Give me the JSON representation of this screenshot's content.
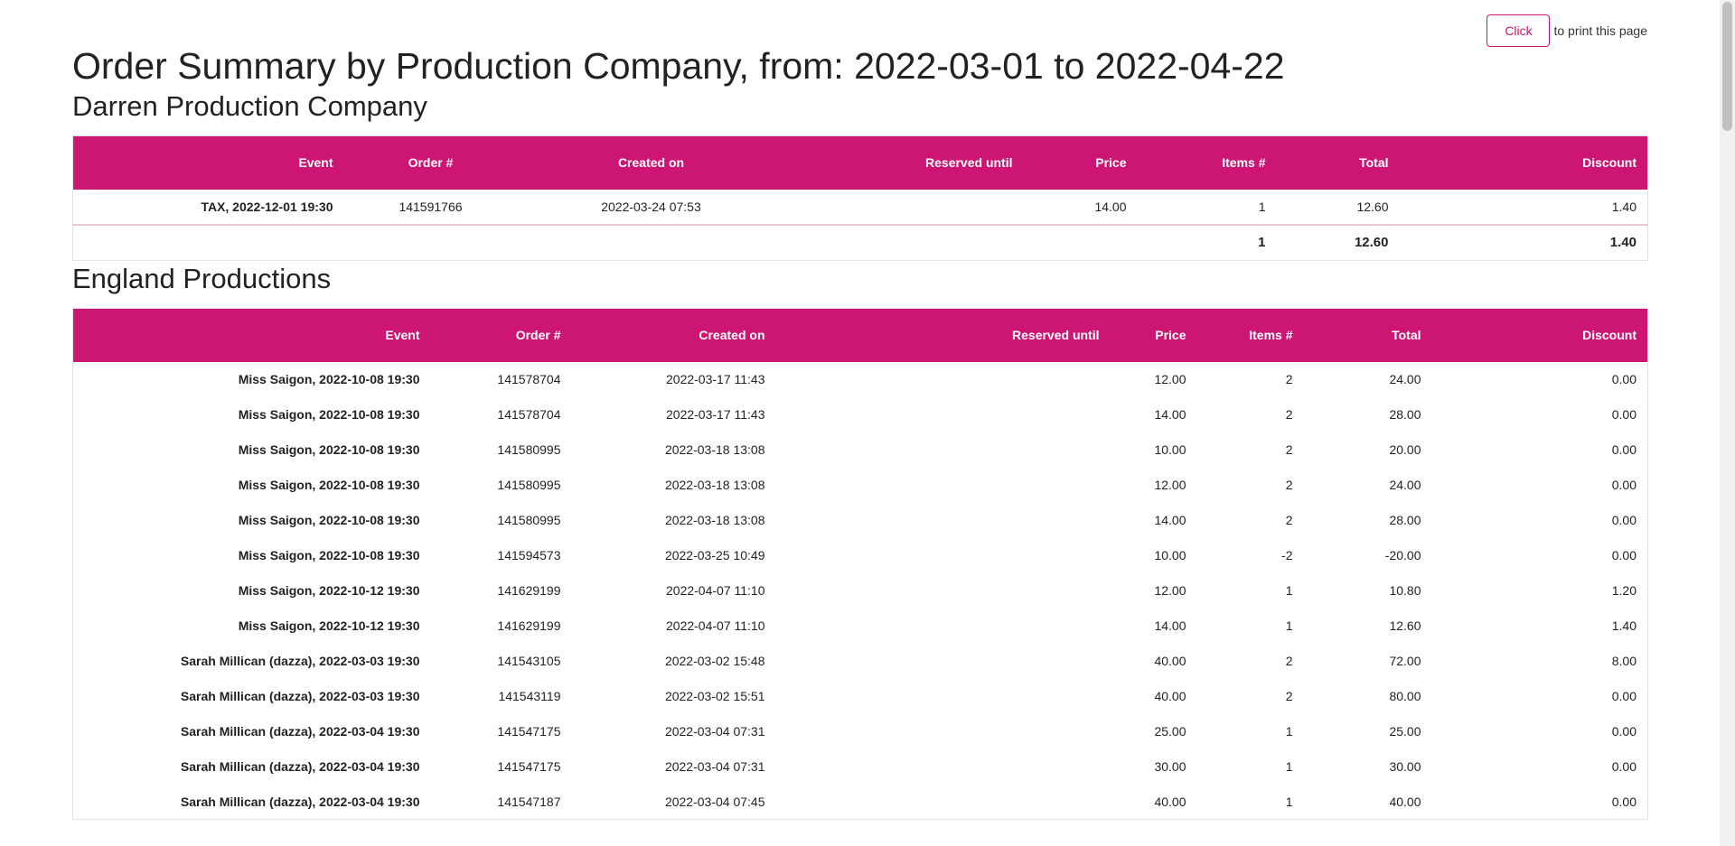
{
  "print": {
    "button_label": "Click",
    "suffix_text": "to print this page"
  },
  "report": {
    "title": "Order Summary by Production Company, from: 2022-03-01 to 2022-04-22"
  },
  "columns_labels": {
    "event": "Event",
    "order": "Order #",
    "created": "Created on",
    "reserved": "Reserved until",
    "price": "Price",
    "items": "Items #",
    "total": "Total",
    "discount": "Discount"
  },
  "companies": [
    {
      "name": "Darren Production Company",
      "rows": [
        {
          "event": "TAX, 2022-12-01 19:30",
          "order": "141591766",
          "created": "2022-03-24 07:53",
          "reserved": "",
          "price": "14.00",
          "items": "1",
          "total": "12.60",
          "discount": "1.40"
        }
      ],
      "totals": {
        "items": "1",
        "total": "12.60",
        "discount": "1.40"
      }
    },
    {
      "name": "England Productions",
      "rows": [
        {
          "event": "Miss Saigon, 2022-10-08 19:30",
          "order": "141578704",
          "created": "2022-03-17 11:43",
          "reserved": "",
          "price": "12.00",
          "items": "2",
          "total": "24.00",
          "discount": "0.00"
        },
        {
          "event": "Miss Saigon, 2022-10-08 19:30",
          "order": "141578704",
          "created": "2022-03-17 11:43",
          "reserved": "",
          "price": "14.00",
          "items": "2",
          "total": "28.00",
          "discount": "0.00"
        },
        {
          "event": "Miss Saigon, 2022-10-08 19:30",
          "order": "141580995",
          "created": "2022-03-18 13:08",
          "reserved": "",
          "price": "10.00",
          "items": "2",
          "total": "20.00",
          "discount": "0.00"
        },
        {
          "event": "Miss Saigon, 2022-10-08 19:30",
          "order": "141580995",
          "created": "2022-03-18 13:08",
          "reserved": "",
          "price": "12.00",
          "items": "2",
          "total": "24.00",
          "discount": "0.00"
        },
        {
          "event": "Miss Saigon, 2022-10-08 19:30",
          "order": "141580995",
          "created": "2022-03-18 13:08",
          "reserved": "",
          "price": "14.00",
          "items": "2",
          "total": "28.00",
          "discount": "0.00"
        },
        {
          "event": "Miss Saigon, 2022-10-08 19:30",
          "order": "141594573",
          "created": "2022-03-25 10:49",
          "reserved": "",
          "price": "10.00",
          "items": "-2",
          "total": "-20.00",
          "discount": "0.00"
        },
        {
          "event": "Miss Saigon, 2022-10-12 19:30",
          "order": "141629199",
          "created": "2022-04-07 11:10",
          "reserved": "",
          "price": "12.00",
          "items": "1",
          "total": "10.80",
          "discount": "1.20"
        },
        {
          "event": "Miss Saigon, 2022-10-12 19:30",
          "order": "141629199",
          "created": "2022-04-07 11:10",
          "reserved": "",
          "price": "14.00",
          "items": "1",
          "total": "12.60",
          "discount": "1.40"
        },
        {
          "event": "Sarah Millican (dazza), 2022-03-03 19:30",
          "order": "141543105",
          "created": "2022-03-02 15:48",
          "reserved": "",
          "price": "40.00",
          "items": "2",
          "total": "72.00",
          "discount": "8.00"
        },
        {
          "event": "Sarah Millican (dazza), 2022-03-03 19:30",
          "order": "141543119",
          "created": "2022-03-02 15:51",
          "reserved": "",
          "price": "40.00",
          "items": "2",
          "total": "80.00",
          "discount": "0.00"
        },
        {
          "event": "Sarah Millican (dazza), 2022-03-04 19:30",
          "order": "141547175",
          "created": "2022-03-04 07:31",
          "reserved": "",
          "price": "25.00",
          "items": "1",
          "total": "25.00",
          "discount": "0.00"
        },
        {
          "event": "Sarah Millican (dazza), 2022-03-04 19:30",
          "order": "141547175",
          "created": "2022-03-04 07:31",
          "reserved": "",
          "price": "30.00",
          "items": "1",
          "total": "30.00",
          "discount": "0.00"
        },
        {
          "event": "Sarah Millican (dazza), 2022-03-04 19:30",
          "order": "141547187",
          "created": "2022-03-04 07:45",
          "reserved": "",
          "price": "40.00",
          "items": "1",
          "total": "40.00",
          "discount": "0.00"
        }
      ]
    }
  ],
  "colors": {
    "accent": "#cd1673",
    "header_text": "#ffffff"
  }
}
